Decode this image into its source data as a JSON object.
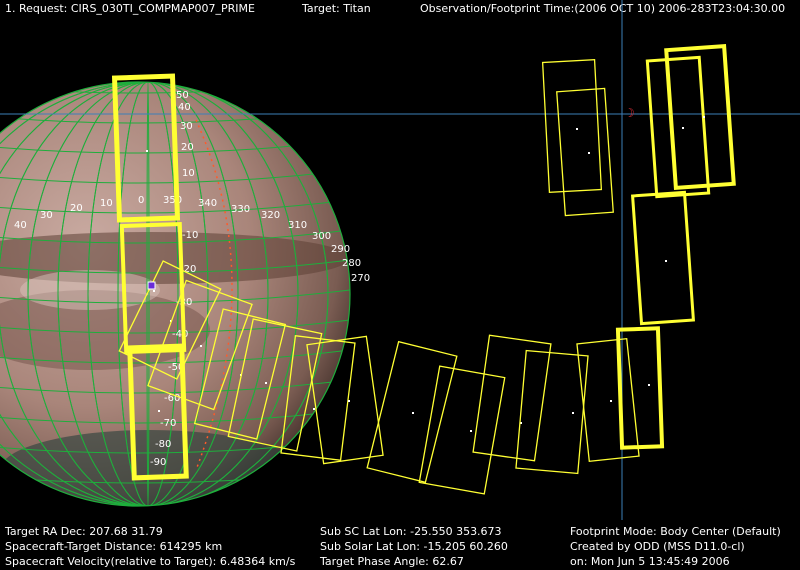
{
  "header": {
    "request": "1. Request:  CIRS_030TI_COMPMAP007_PRIME",
    "target": "Target: Titan",
    "time": "Observation/Footprint Time:(2006 OCT 10) 2006-283T23:04:30.00"
  },
  "footer": {
    "ra_dec": "Target RA  Dec: 207.68  31.79",
    "distance": "Spacecraft-Target Distance:  614295 km",
    "velocity": "Spacecraft Velocity(relative to Target): 6.48364 km/s",
    "sub_sc": "Sub SC Lat Lon: -25.550  353.673",
    "sub_solar": "Sub Solar Lat Lon: -15.205  60.260",
    "phase": "Target Phase Angle: 62.67",
    "footprint_mode": "Footprint Mode: Body Center (Default)",
    "created_by": "Created by ODD (MSS D11.0-cl)",
    "created_on": "on: Mon Jun  5 13:45:49 2006"
  },
  "lat_labels": [
    "50",
    "40",
    "30",
    "20",
    "10",
    "0",
    "-10",
    "-20",
    "-30",
    "-40",
    "-50",
    "-60",
    "-70",
    "-80",
    "-90"
  ],
  "lon_labels": [
    "40",
    "30",
    "20",
    "10",
    "350",
    "340",
    "330",
    "320",
    "310",
    "300",
    "290",
    "280",
    "270"
  ],
  "sun_marker": "☽",
  "colors": {
    "footprint": "#ffff33",
    "grid": "#1fae3c",
    "crosshair": "#3d7fb8",
    "terminator": "#ff5a2a"
  }
}
